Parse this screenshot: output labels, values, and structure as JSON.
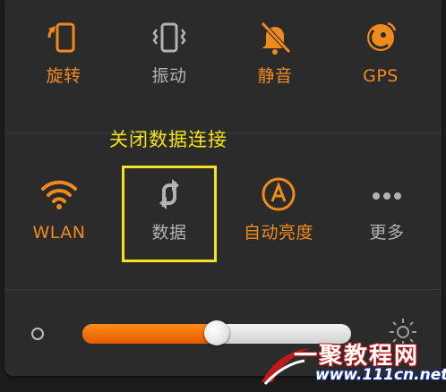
{
  "toggles_row1": [
    {
      "label": "旋转",
      "icon": "rotate-icon",
      "active": true
    },
    {
      "label": "振动",
      "icon": "vibrate-icon",
      "active": false
    },
    {
      "label": "静音",
      "icon": "mute-icon",
      "active": true
    },
    {
      "label": "GPS",
      "icon": "gps-icon",
      "active": true
    }
  ],
  "toggles_row2": [
    {
      "label": "WLAN",
      "icon": "wifi-icon",
      "active": true
    },
    {
      "label": "数据",
      "icon": "data-icon",
      "active": false
    },
    {
      "label": "自动亮度",
      "icon": "auto-brightness-icon",
      "active": true
    },
    {
      "label": "更多",
      "icon": "more-icon",
      "active": false
    }
  ],
  "annotation": {
    "text": "关闭数据连接"
  },
  "brightness": {
    "level": 0.5
  },
  "watermark": {
    "line1": "一聚教程网",
    "line2": "www.111cn.net"
  },
  "colors": {
    "active": "#f08a1d",
    "inactive": "#b2b2b2",
    "annotation": "#f3e31b",
    "panel": "#2b2b2b"
  }
}
